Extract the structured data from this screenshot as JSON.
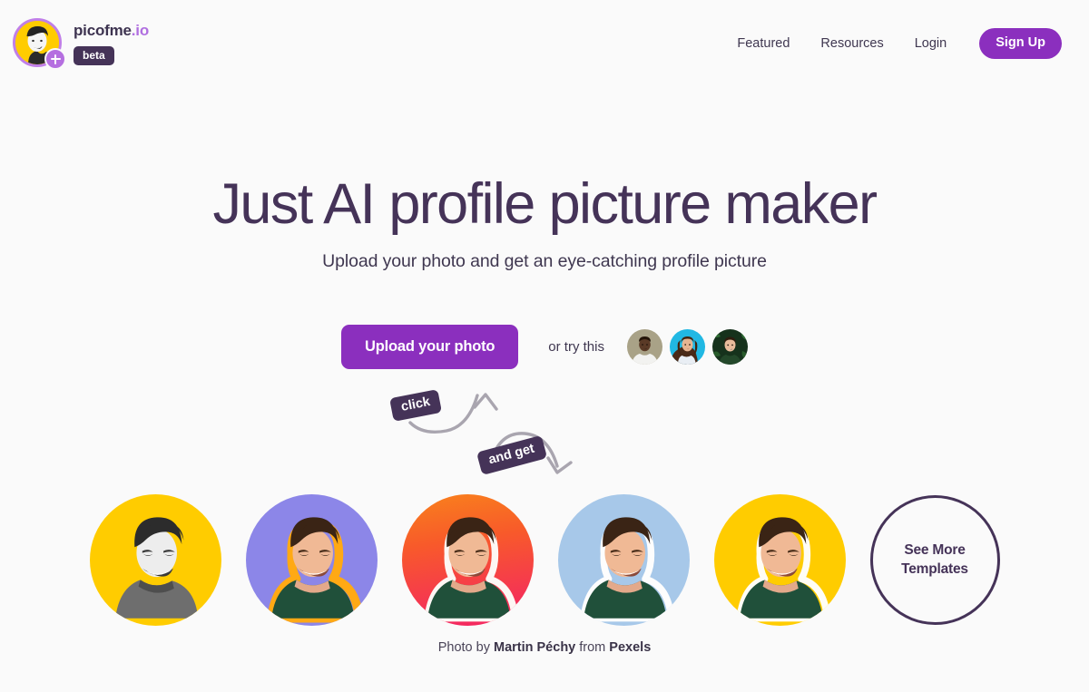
{
  "header": {
    "brand": {
      "name": "picofme",
      "tld": ".io",
      "beta_label": "beta",
      "logo_icon": "avatar-plus-icon"
    },
    "nav": [
      {
        "label": "Featured",
        "name": "nav-link-featured"
      },
      {
        "label": "Resources",
        "name": "nav-link-resources"
      },
      {
        "label": "Login",
        "name": "nav-link-login"
      }
    ],
    "signup_label": "Sign Up"
  },
  "hero": {
    "title": "Just AI profile picture maker",
    "subtitle": "Upload your photo and get an eye-catching profile picture"
  },
  "cta": {
    "upload_label": "Upload your photo",
    "or_try_label": "or try this",
    "sample_photos": [
      {
        "name": "sample-photo-1",
        "alt": "man in white shirt on khaki background",
        "bg": "#A8A183"
      },
      {
        "name": "sample-photo-2",
        "alt": "woman with long brown hair on cyan background",
        "bg": "#22B6E0"
      },
      {
        "name": "sample-photo-3",
        "alt": "man among green leaves",
        "bg": "#1E3A22"
      }
    ]
  },
  "annotations": {
    "click_label": "click",
    "and_get_label": "and get"
  },
  "gallery": {
    "templates": [
      {
        "name": "template-yellow-mono",
        "bg": "#FFCC00",
        "style": "grayscale",
        "outline": "none"
      },
      {
        "name": "template-periwinkle-outline",
        "bg": "#8C86E8",
        "style": "color",
        "outline": "#FFA914"
      },
      {
        "name": "template-orange-pink-gradient",
        "bg": "linear-gradient(180deg,#F97A1E 0%,#F9551F 38%,#F42A5C 100%)",
        "style": "color",
        "outline": "none"
      },
      {
        "name": "template-light-blue",
        "bg": "#A7C8E9",
        "style": "color",
        "outline": "none"
      },
      {
        "name": "template-yellow",
        "bg": "#FFCC00",
        "style": "color",
        "outline": "none"
      }
    ],
    "see_more_label": "See More Templates"
  },
  "credit": {
    "prefix": "Photo by ",
    "author": "Martin Péchy",
    "middle": " from ",
    "source": "Pexels"
  },
  "colors": {
    "background": "#FAFAFA",
    "brand_purple": "#8B2FBE",
    "logo_purple": "#B06FE0",
    "ink": "#453358",
    "yellow": "#FFCC00"
  }
}
